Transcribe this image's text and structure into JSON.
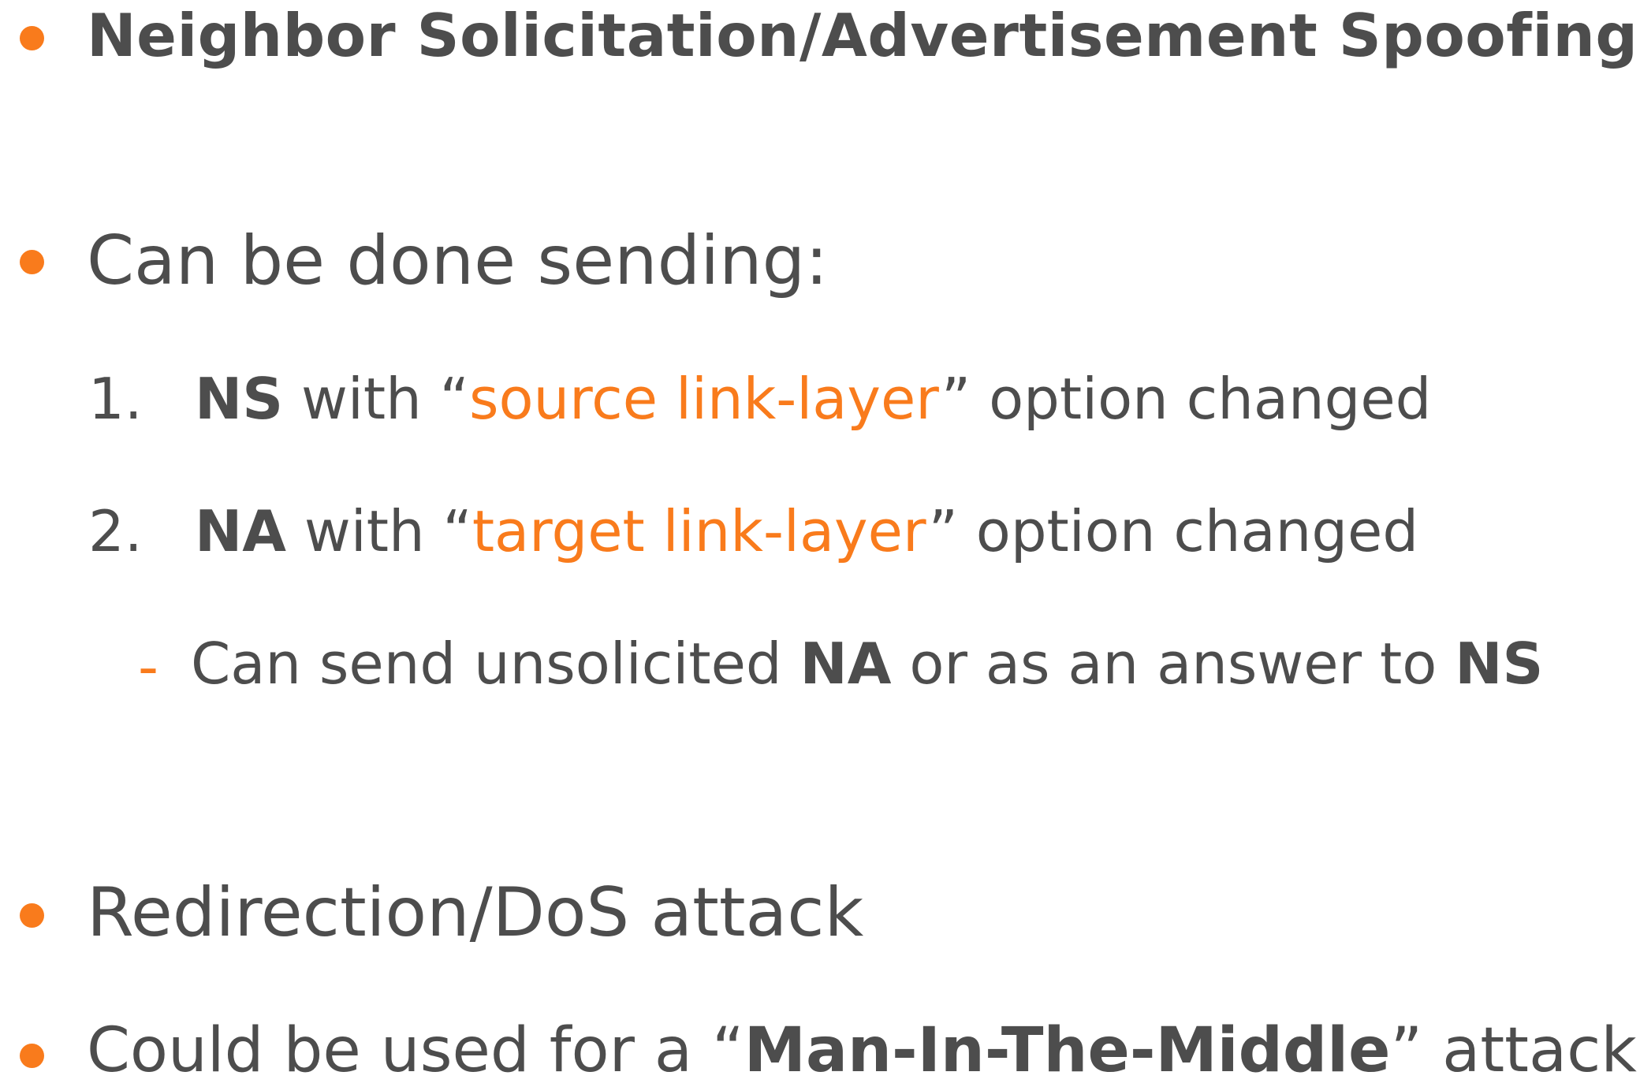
{
  "slide": {
    "title": "Neighbor Solicitation/Advertisement Spoofing",
    "bullet2": "Can be done sending:",
    "items": [
      {
        "number": "1.",
        "bold": "NS",
        "pre": " with “",
        "highlight": "source link-layer",
        "post": "” option changed"
      },
      {
        "number": "2.",
        "bold": "NA",
        "pre": " with “",
        "highlight": "target link-layer",
        "post": "” option changed"
      }
    ],
    "sub_dash": "-",
    "sub": {
      "pre": "Can send unsolicited ",
      "bold1": "NA",
      "mid": " or as an answer to ",
      "bold2": "NS"
    },
    "bullet3": "Redirection/DoS attack",
    "bullet4": {
      "pre": "Could be used for a “",
      "bold": "Man-In-The-Middle",
      "post": "” attack"
    }
  },
  "colors": {
    "accent": "#f97b1c",
    "text": "#4d4d4d",
    "background": "#ffffff"
  }
}
